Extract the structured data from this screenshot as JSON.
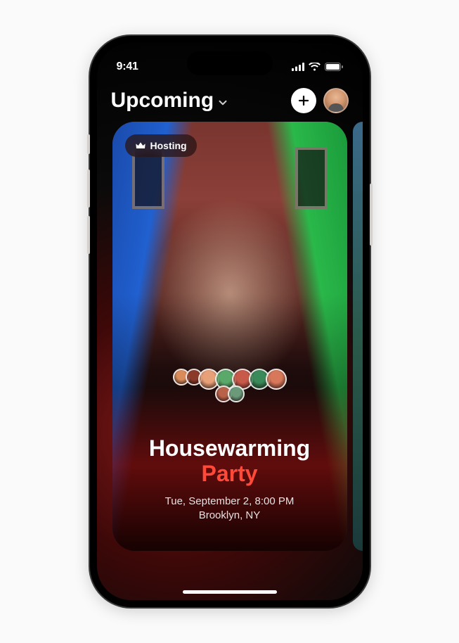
{
  "status_bar": {
    "time": "9:41"
  },
  "header": {
    "title": "Upcoming"
  },
  "event": {
    "badge_label": "Hosting",
    "title_line1": "Housewarming",
    "title_line2": "Party",
    "datetime": "Tue, September 2, 8:00 PM",
    "location": "Brooklyn, NY",
    "attendee_colors": [
      "#d98b5a",
      "#8b3a2a",
      "#e8a078",
      "#5aa86a",
      "#c85a4a",
      "#3a8a5a",
      "#d8785a",
      "#b8624a",
      "#6a9a7a"
    ]
  }
}
